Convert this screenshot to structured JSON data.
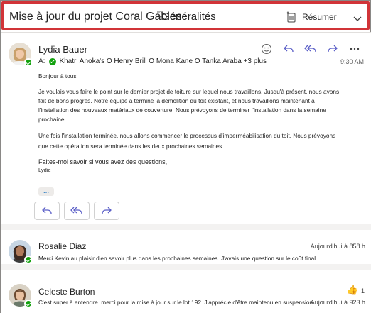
{
  "header": {
    "subject": "Mise à jour du projet Coral Gables",
    "topic": "Généralités",
    "summarize_label": "Résumer"
  },
  "message1": {
    "sender": "Lydia Bauer",
    "to_label": "À:",
    "recipients": "Khatri Anoka's O Henry Brill O Mona Kane O Tanka Araba +3 plus",
    "time": "9:30 AM",
    "greeting": "Bonjour à tous",
    "para1": "Je voulais vous faire le point sur le dernier projet de toiture sur lequel nous travaillons. Jusqu'à présent. nous avons fait de bons progrès. Notre équipe a terminé la démolition du toit existant, et nous travaillons maintenant à l'installation des nouveaux matériaux de couverture. Nous prévoyons de terminer l'installation dans la semaine prochaine.",
    "para2": "Une fois l'installation terminée, nous allons commencer le processus d'imperméabilisation du toit. Nous prévoyons que cette opération sera terminée dans les deux prochaines semaines.",
    "closing": "Faites-moi savoir si vous avez des questions,",
    "signature": "Lydie",
    "more": "..."
  },
  "message2": {
    "sender": "Rosalie Diaz",
    "preview": "Merci Kevin au plaisir d'en savoir plus dans les prochaines semaines. J'avais une question sur le coût final",
    "time": "Aujourd'hui à 858 h"
  },
  "message3": {
    "sender": "Celeste Burton",
    "preview": "C'est super à entendre. merci pour la mise à jour sur le lot 192. J'apprécie d'être maintenu en suspension",
    "time": "Aujourd'hui à 923 h",
    "reaction": "👍",
    "reaction_count": "1"
  },
  "icons": {
    "topic": "tag-icon",
    "summarize": "sparkle-doc-icon",
    "collapse": "chevron-down-icon",
    "emoji": "emoji-icon",
    "reply": "reply-icon",
    "reply_all": "reply-all-icon",
    "forward": "forward-icon",
    "more": "more-icon"
  },
  "colors": {
    "accent": "#0f6cbd",
    "highlight_border": "#d13438",
    "presence": "#13a10e"
  }
}
